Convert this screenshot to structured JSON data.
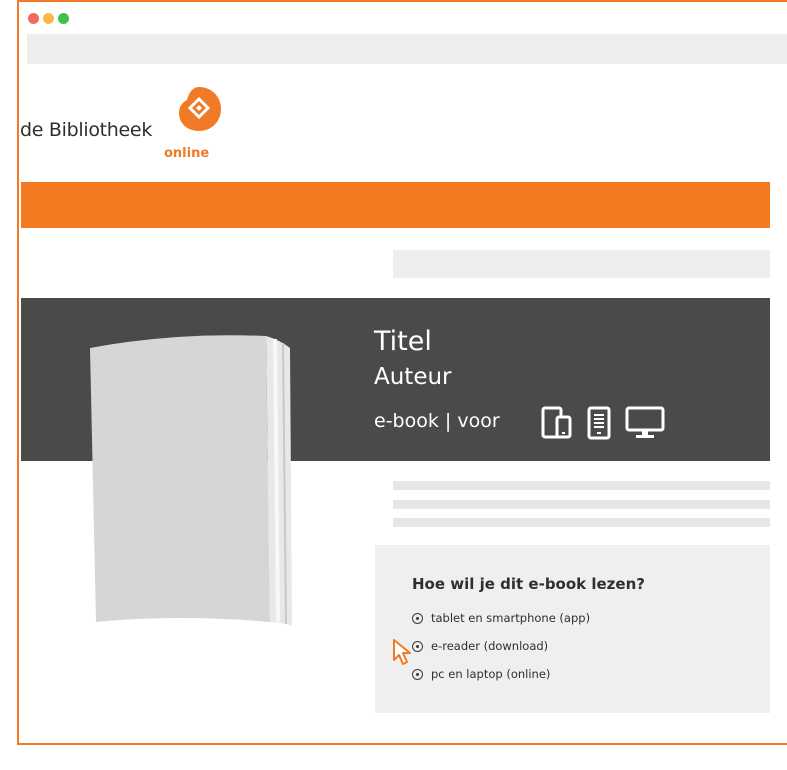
{
  "window": {
    "traffic_lights": [
      {
        "name": "close",
        "color": "#f26b5e"
      },
      {
        "name": "minimize",
        "color": "#f7b94a"
      },
      {
        "name": "maximize",
        "color": "#3ec247"
      }
    ]
  },
  "logo": {
    "text": "de Bibliotheek",
    "subtext": "online",
    "icon": "bibliotheek-logo-icon",
    "accent_color": "#f07a25"
  },
  "book": {
    "title": "Titel",
    "author": "Auteur",
    "format_label": "e-book | voor",
    "device_icons": [
      "tablet-smartphone-icon",
      "e-reader-icon",
      "desktop-icon"
    ]
  },
  "read_options": {
    "question": "Hoe wil je dit e-book lezen?",
    "options": [
      "tablet en smartphone (app)",
      "e-reader (download)",
      "pc en laptop (online)"
    ]
  },
  "colors": {
    "brand_orange": "#f47a20",
    "hero_background": "#4a4a49",
    "placeholder_gray": "#ededed"
  }
}
